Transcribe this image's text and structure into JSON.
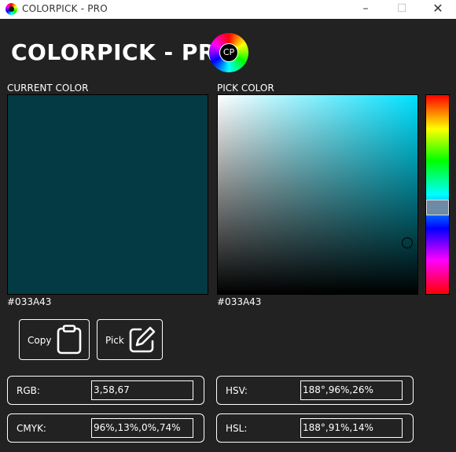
{
  "window": {
    "title": "COLORPICK - PRO",
    "minimize": "–",
    "maximize": "☐",
    "close": "✕"
  },
  "header": {
    "title": "COLORPICK - PRO",
    "logo_text": "CP"
  },
  "current": {
    "label": "CURRENT COLOR",
    "hex": "#033A43",
    "color": "#033A43"
  },
  "picker": {
    "label": "PICK COLOR",
    "hex": "#033A43",
    "hue_color": "#00E1FF"
  },
  "actions": {
    "copy_label": "Copy",
    "pick_label": "Pick"
  },
  "fields": {
    "rgb": {
      "label": "RGB:",
      "value": "3,58,67"
    },
    "cmyk": {
      "label": "CMYK:",
      "value": "96%,13%,0%,74%"
    },
    "hsv": {
      "label": "HSV:",
      "value": "188°,96%,26%"
    },
    "hsl": {
      "label": "HSL:",
      "value": "188°,91%,14%"
    }
  }
}
